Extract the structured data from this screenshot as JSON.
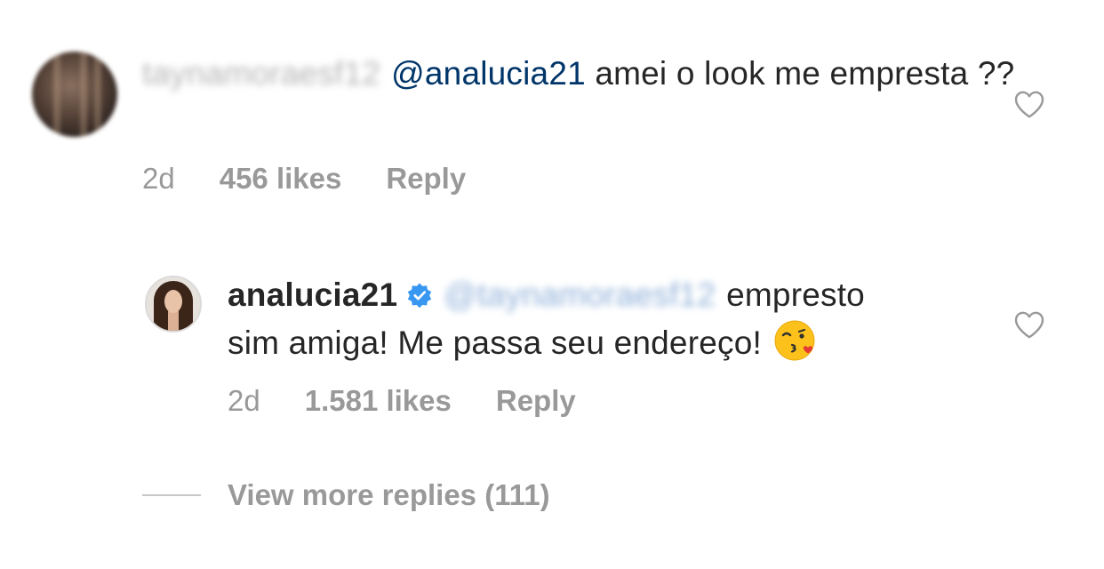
{
  "comments": [
    {
      "username": "taynamoraesf12",
      "mention": "@analucia21",
      "text": "amei o look me empresta ??",
      "time": "2d",
      "likes": "456 likes",
      "reply": "Reply",
      "username_blurred": true
    },
    {
      "username": "analucia21",
      "verified": true,
      "mention": "@taynamoraesf12",
      "text_line1": "empresto",
      "text_line2": "sim amiga! Me passa seu endereço!",
      "emoji": "kissing-face-with-heart",
      "time": "2d",
      "likes": "1.581 likes",
      "reply": "Reply",
      "mention_blurred": true
    }
  ],
  "view_more": "View more replies (111)",
  "colors": {
    "text": "#262626",
    "secondary": "#999999",
    "mention": "#003569",
    "verified": "#3897f0"
  },
  "icons": {
    "like": "heart-outline-icon",
    "verified": "verified-badge-icon"
  }
}
